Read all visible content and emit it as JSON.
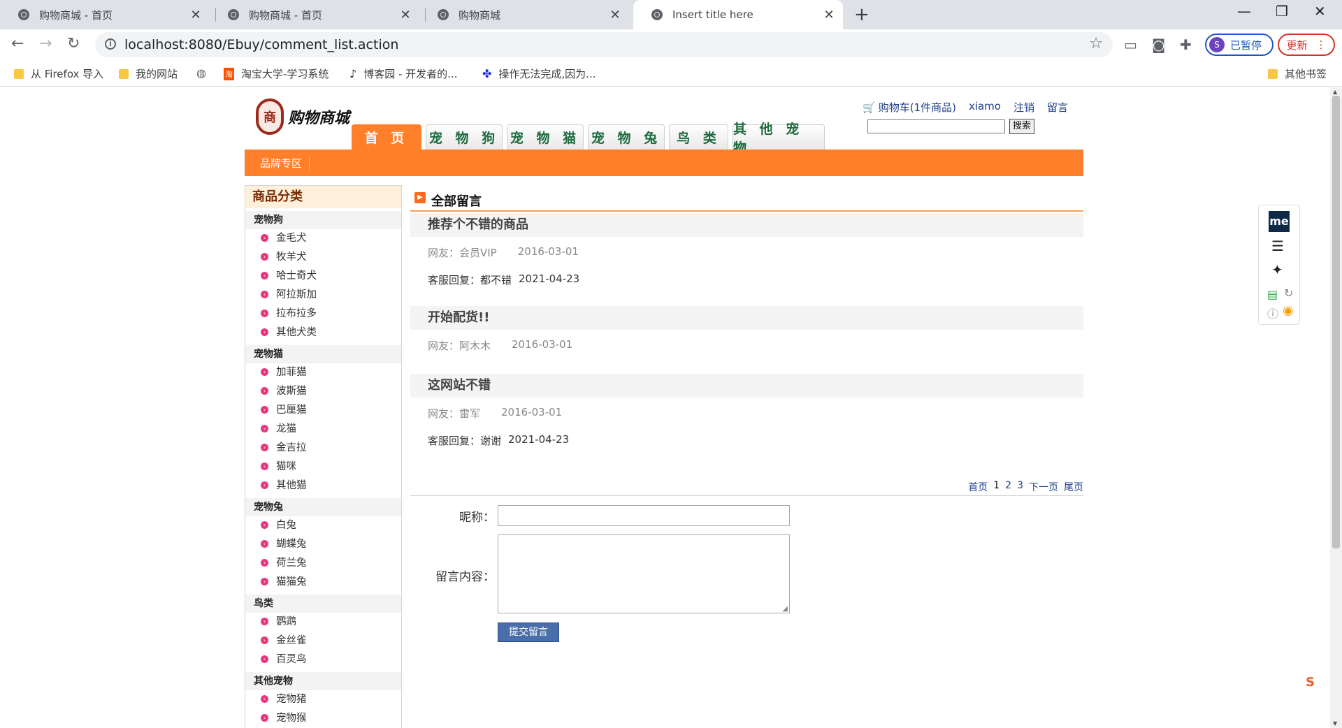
{
  "browser": {
    "tabs": [
      {
        "title": "购物商城 - 首页"
      },
      {
        "title": "购物商城 - 首页"
      },
      {
        "title": "购物商城"
      },
      {
        "title": "Insert title here"
      }
    ],
    "url": "localhost:8080/Ebuy/comment_list.action",
    "profile_label": "已暂停",
    "profile_initial": "S",
    "update_label": "更新",
    "bookmarks": [
      {
        "label": "从 Firefox 导入",
        "icon": "folder-icon"
      },
      {
        "label": "我的网站",
        "icon": "folder-icon"
      },
      {
        "label": "",
        "icon": "globe-icon"
      },
      {
        "label": "淘宝大学-学习系统",
        "icon": "taobao-icon"
      },
      {
        "label": "博客园 - 开发者的...",
        "icon": "cnblogs-icon"
      },
      {
        "label": "操作无法完成,因为...",
        "icon": "baidu-icon"
      }
    ],
    "other_bookmarks": "其他书签"
  },
  "site": {
    "logo_text": "购物商城",
    "logo_seal": "商",
    "top_links": {
      "cart": "购物车(1件商品)",
      "user": "xiamo",
      "logout": "注销",
      "message": "留言"
    },
    "search_button": "搜索",
    "nav": [
      "首 页",
      "宠 物 狗",
      "宠 物 猫",
      "宠 物 兔",
      "鸟 类",
      "其 他 宠 物"
    ],
    "brand_link": "品牌专区"
  },
  "sidebar": {
    "title": "商品分类",
    "categories": [
      {
        "name": "宠物狗",
        "items": [
          "金毛犬",
          "牧羊犬",
          "哈士奇犬",
          "阿拉斯加",
          "拉布拉多",
          "其他犬类"
        ]
      },
      {
        "name": "宠物猫",
        "items": [
          "加菲猫",
          "波斯猫",
          "巴厘猫",
          "龙猫",
          "金吉拉",
          "猫咪",
          "其他猫"
        ]
      },
      {
        "name": "宠物兔",
        "items": [
          "白兔",
          "蝴蝶兔",
          "荷兰兔",
          "猫猫兔"
        ]
      },
      {
        "name": "鸟类",
        "items": [
          "鹦鹉",
          "金丝雀",
          "百灵鸟"
        ]
      },
      {
        "name": "其他宠物",
        "items": [
          "宠物猪",
          "宠物猴"
        ]
      }
    ]
  },
  "content": {
    "heading": "全部留言",
    "comments": [
      {
        "title": "推荐个不错的商品",
        "author": "网友：会员VIP",
        "date": "2016-03-01",
        "reply_label": "客服回复：都不错",
        "reply_date": "2021-04-23"
      },
      {
        "title": "开始配货!!",
        "author": "网友：阿木木",
        "date": "2016-03-01",
        "reply_label": "",
        "reply_date": ""
      },
      {
        "title": "这网站不错",
        "author": "网友：雷军",
        "date": "2016-03-01",
        "reply_label": "客服回复：谢谢",
        "reply_date": "2021-04-23"
      }
    ],
    "pager": {
      "first": "首页",
      "pages": [
        "1",
        "2",
        "3"
      ],
      "next": "下一页",
      "last": "尾页"
    },
    "form": {
      "nickname_label": "昵称：",
      "content_label": "留言内容：",
      "submit_label": "提交留言"
    }
  }
}
